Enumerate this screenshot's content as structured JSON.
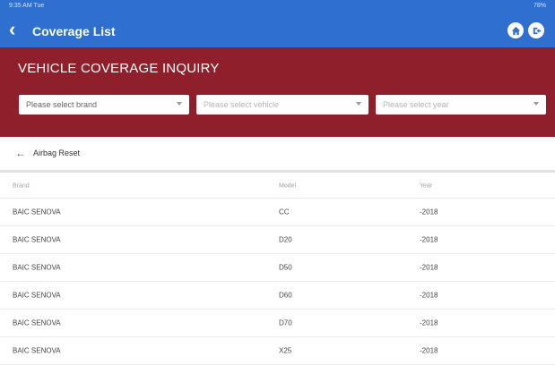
{
  "status": {
    "left": "9:35 AM Tue",
    "right": "78%"
  },
  "appbar": {
    "back_glyph": "‹",
    "title": "Coverage List",
    "home_icon": "home-icon",
    "exit_icon": "exit-icon"
  },
  "banner": {
    "title": "VEHICLE COVERAGE INQUIRY",
    "brand_placeholder": "Please select brand",
    "vehicle_placeholder": "Please select vehicle",
    "year_placeholder": "Please select year"
  },
  "subheader": {
    "back_glyph": "←",
    "title": "Airbag Reset"
  },
  "table": {
    "headers": [
      "Brand",
      "Model",
      "Year"
    ],
    "rows": [
      [
        "BAIC SENOVA",
        "CC",
        "-2018"
      ],
      [
        "BAIC SENOVA",
        "D20",
        "-2018"
      ],
      [
        "BAIC SENOVA",
        "D50",
        "-2018"
      ],
      [
        "BAIC SENOVA",
        "D60",
        "-2018"
      ],
      [
        "BAIC SENOVA",
        "D70",
        "-2018"
      ],
      [
        "BAIC SENOVA",
        "X25",
        "-2018"
      ]
    ]
  },
  "colors": {
    "primary": "#2e6fd0",
    "banner": "#8f1f2b"
  }
}
